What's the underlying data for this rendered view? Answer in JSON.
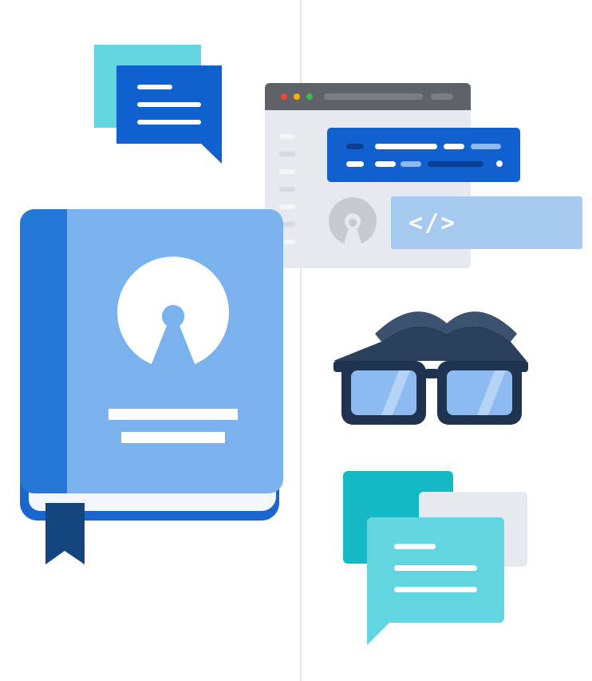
{
  "illustration": {
    "code_glyph": "</>",
    "colors": {
      "book_cover": "#7ab2ee",
      "book_spine": "#2477d6",
      "book_ribbon": "#14457f",
      "bubble_blue": "#1060d0",
      "bubble_teal": "#62d6e0",
      "teal_dark": "#15b9c6",
      "browser_bar": "#5f6368",
      "browser_body": "#e6e9ef",
      "glasses_frame": "#1f3350",
      "glasses_lens": "#8dbaf0",
      "divider": "#e6e6e6"
    },
    "icons": [
      "chat-bubbles-icon",
      "browser-window-icon",
      "code-snippet-icon",
      "open-source-book-icon",
      "glasses-icon",
      "chat-bubbles-icon"
    ]
  }
}
